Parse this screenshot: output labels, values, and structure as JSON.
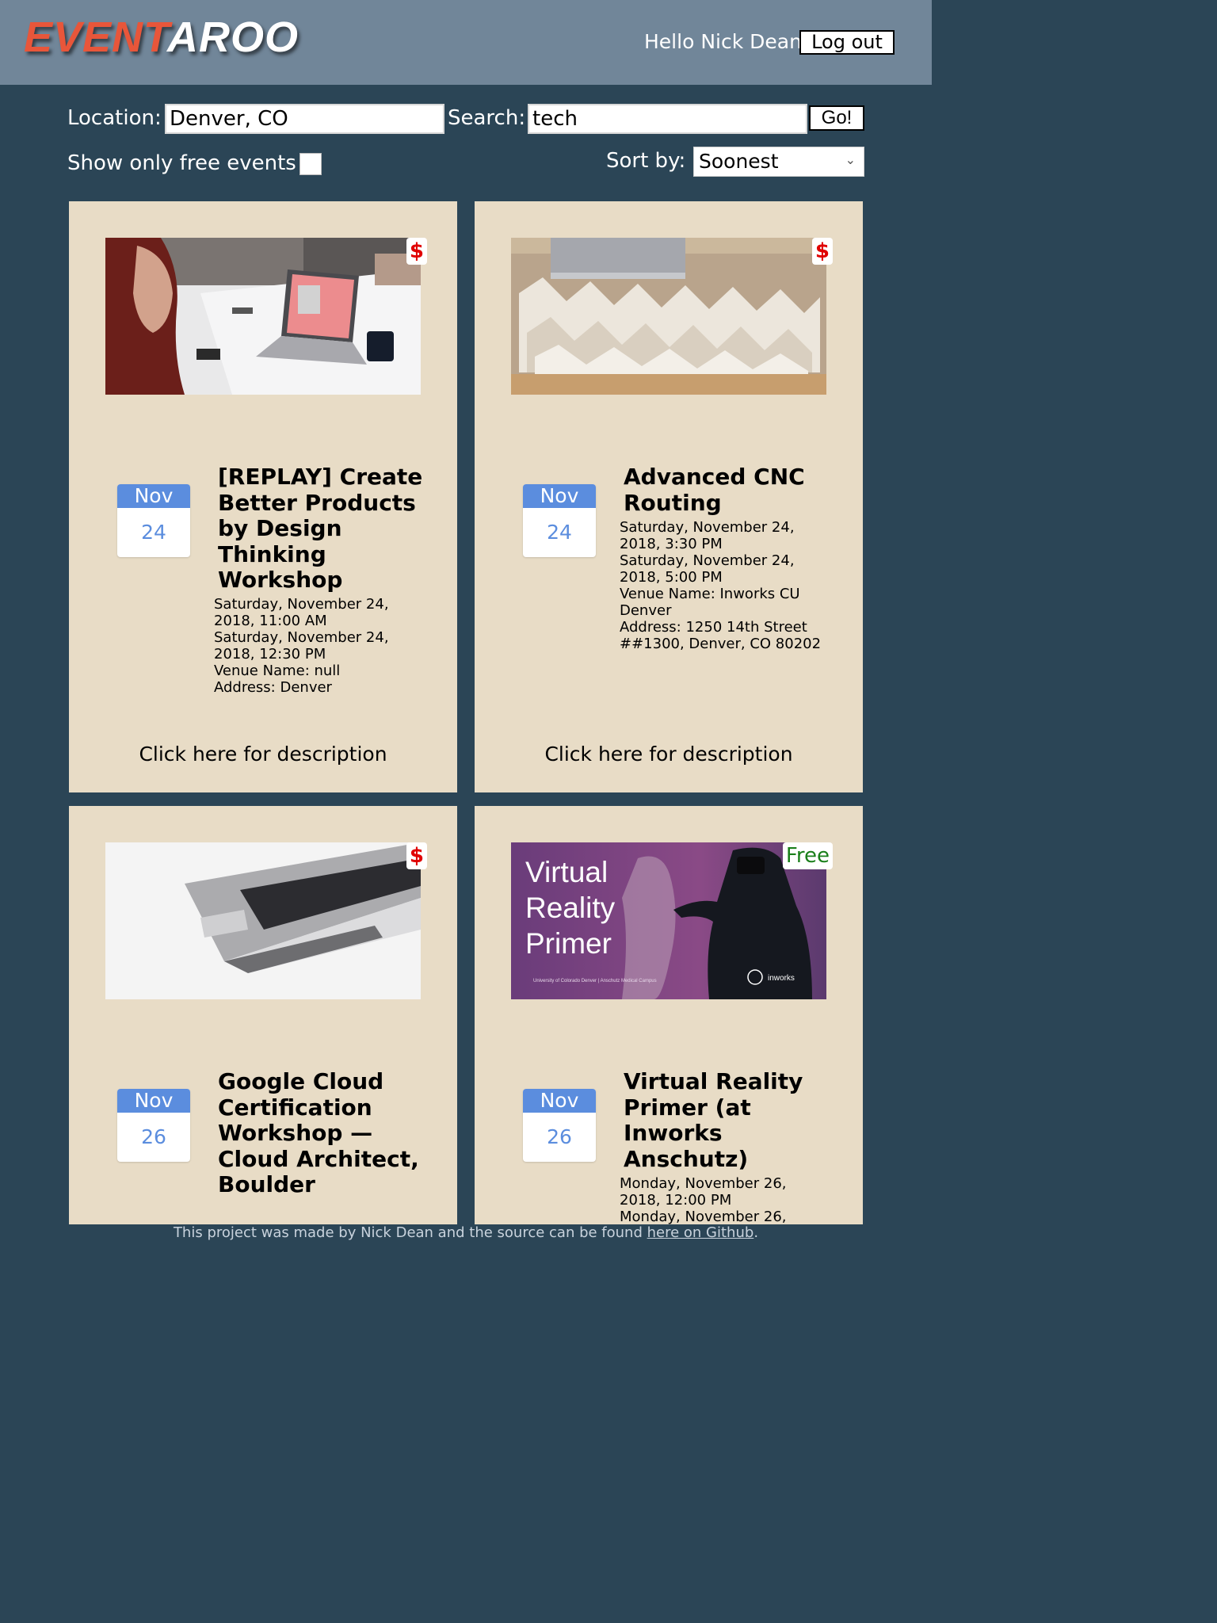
{
  "header": {
    "logo_part1": "EVENT",
    "logo_part2": "AROO",
    "greeting": "Hello Nick Dean",
    "logout_label": "Log out"
  },
  "filters": {
    "location_label": "Location:",
    "location_value": "Denver, CO",
    "search_label": "Search:",
    "search_value": "tech",
    "go_label": "Go!",
    "free_only_label": "Show only free events",
    "free_only_checked": false,
    "sort_label": "Sort by:",
    "sort_value": "Soonest"
  },
  "events": [
    {
      "badge": "$",
      "month": "Nov",
      "day": "24",
      "title": "[REPLAY] Create Better Products by Design Thinking Workshop",
      "start": "Saturday, November 24, 2018, 11:00 AM",
      "end": "Saturday, November 24, 2018, 12:30 PM",
      "venue": "Venue Name: null",
      "address": "Address: Denver",
      "desc_link": "Click here for description"
    },
    {
      "badge": "$",
      "month": "Nov",
      "day": "24",
      "title": "Advanced CNC Routing",
      "start": "Saturday, November 24, 2018, 3:30 PM",
      "end": "Saturday, November 24, 2018, 5:00 PM",
      "venue": "Venue Name: Inworks CU Denver",
      "address": "Address: 1250 14th Street ##1300, Denver, CO 80202",
      "desc_link": "Click here for description"
    },
    {
      "badge": "$",
      "month": "Nov",
      "day": "26",
      "title": "Google Cloud Certification Workshop —Cloud Architect, Boulder"
    },
    {
      "badge": "Free",
      "month": "Nov",
      "day": "26",
      "title": "Virtual Reality Primer (at Inworks Anschutz)",
      "image_text_1": "Virtual",
      "image_text_2": "Reality",
      "image_text_3": "Primer",
      "image_caption": "University of Colorado Denver | Anschutz Medical Campus",
      "image_brand": "inworks",
      "start": "Monday, November 26, 2018, 12:00 PM",
      "end": "Monday, November 26,"
    }
  ],
  "footer": {
    "text_before": "This project was made by Nick Dean and the source can be found ",
    "link_label": "here on Github",
    "text_after": "."
  }
}
